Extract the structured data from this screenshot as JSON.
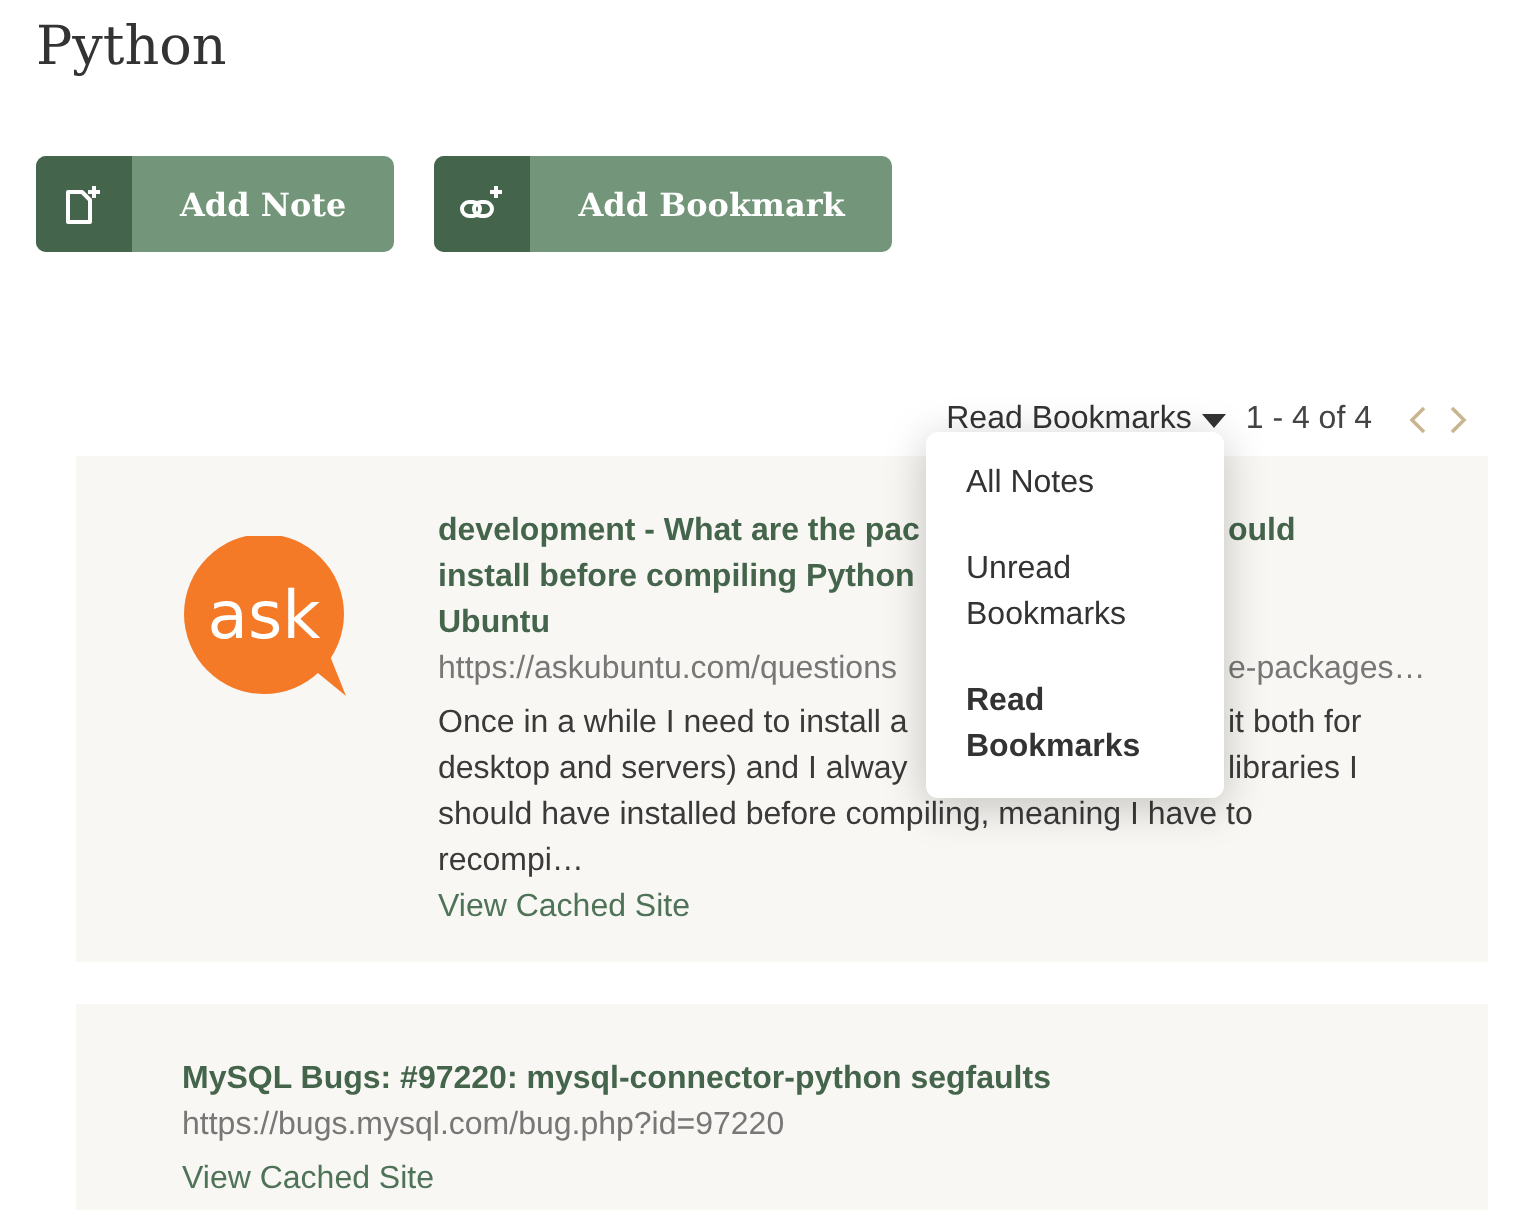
{
  "page_title": "Python",
  "actions": [
    {
      "kind": "note",
      "label": "Add Note"
    },
    {
      "kind": "bookmark",
      "label": "Add Bookmark"
    }
  ],
  "pager": {
    "filter_label": "Read Bookmarks",
    "expanded": true,
    "range": "1 - 4 of 4"
  },
  "filter_menu": [
    {
      "label": "All Notes",
      "selected": false
    },
    {
      "label": "Unread Bookmarks",
      "selected": false
    },
    {
      "label": "Read Bookmarks",
      "selected": true
    }
  ],
  "bookmarks": [
    {
      "logo_text": "ask",
      "title_lines": [
        {
          "left": "development - What are the pac",
          "right": "ould"
        },
        {
          "left": "install before compiling Python"
        },
        {
          "left": "Ubuntu"
        }
      ],
      "url": {
        "left": "https://askubuntu.com/questions",
        "right": "e-packages…"
      },
      "excerpt_lines": [
        {
          "left": "Once in a while I need to install a",
          "right": "it both for"
        },
        {
          "left": "desktop and servers) and I alway",
          "right": "libraries I"
        },
        {
          "left": "should have installed before compiling, meaning I have to"
        },
        {
          "left": "recompi…"
        }
      ],
      "link": "View Cached Site"
    },
    {
      "title_lines": [
        {
          "left": "MySQL Bugs: #97220: mysql-connector-python segfaults"
        }
      ],
      "url": {
        "left": "https://bugs.mysql.com/bug.php?id=97220"
      },
      "link": "View Cached Site"
    }
  ]
}
